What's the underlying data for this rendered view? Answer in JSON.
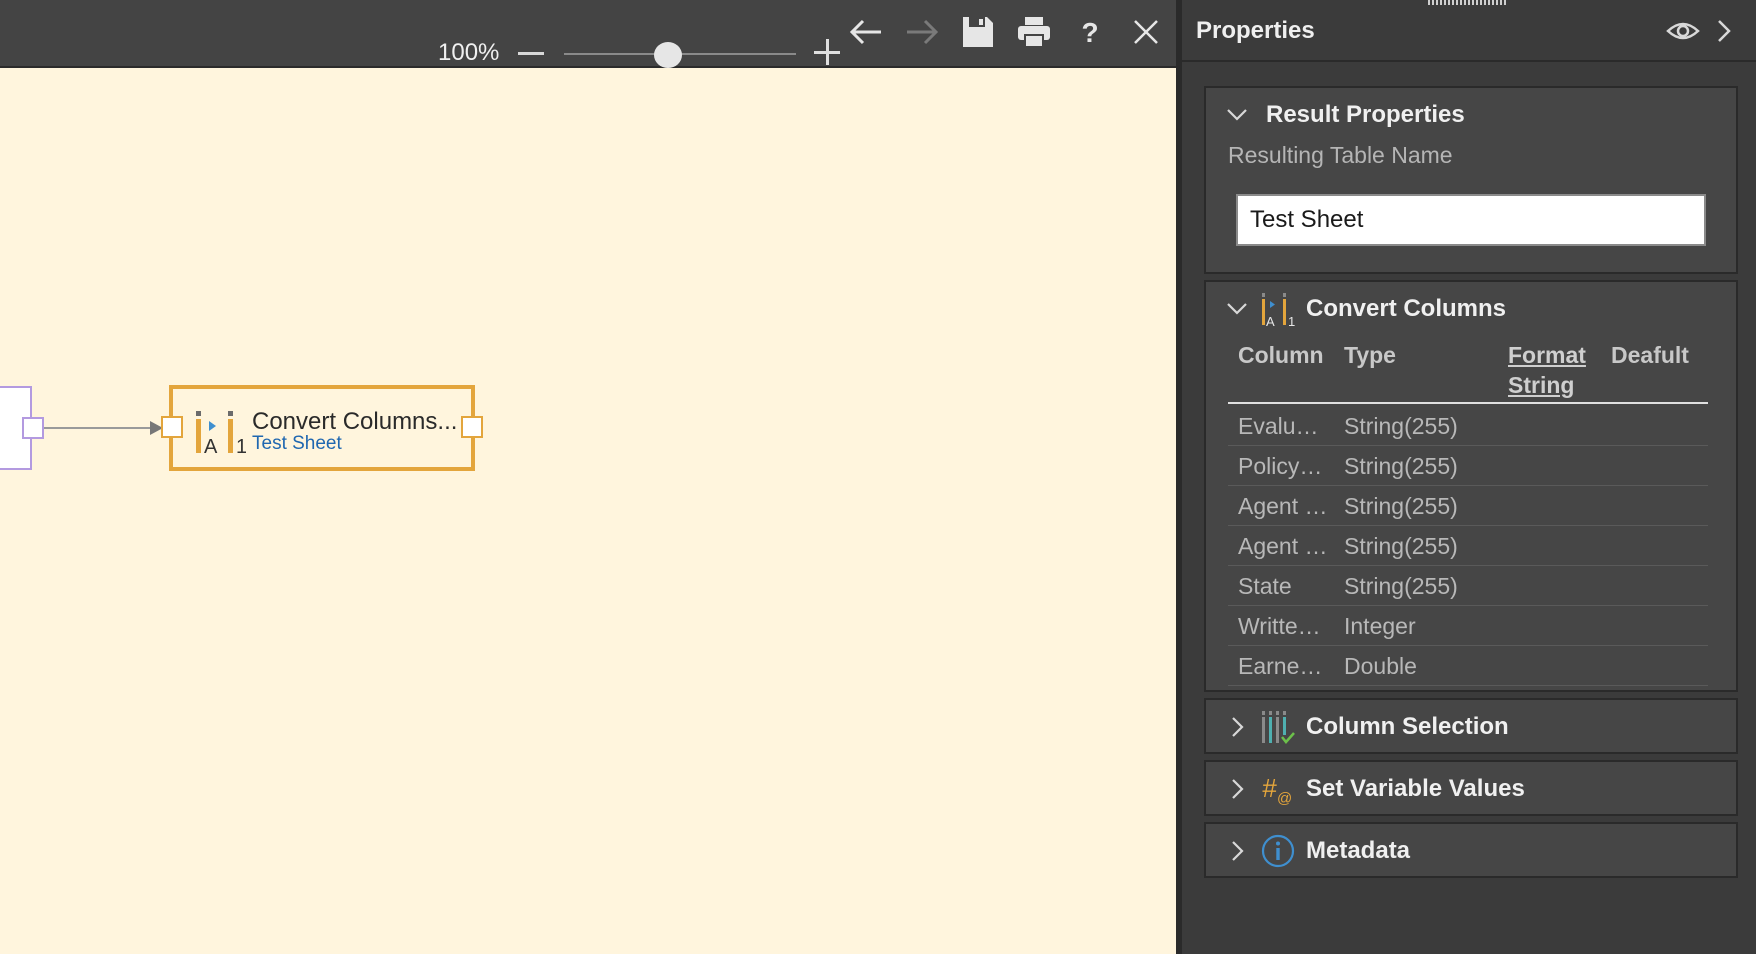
{
  "toolbar": {
    "zoom_label": "100%",
    "zoom_value": 0.45,
    "icons": [
      "back-arrow-icon",
      "forward-arrow-icon",
      "save-icon",
      "print-icon",
      "help-icon",
      "close-icon"
    ]
  },
  "canvas": {
    "background": "#fff5dd",
    "node": {
      "title": "Convert Columns...",
      "subtitle": "Test Sheet",
      "border_color": "#e3a53c"
    }
  },
  "panel": {
    "title": "Properties",
    "result": {
      "title": "Result Properties",
      "label": "Resulting Table Name",
      "value": "Test Sheet"
    },
    "convert": {
      "title": "Convert Columns",
      "headers": {
        "column": "Column",
        "type": "Type",
        "format_line1": "Format",
        "format_line2": "String",
        "default": "Deafult"
      },
      "rows": [
        {
          "column": "Evalu…",
          "type": "String(255)"
        },
        {
          "column": "Policy…",
          "type": "String(255)"
        },
        {
          "column": "Agent …",
          "type": "String(255)"
        },
        {
          "column": "Agent …",
          "type": "String(255)"
        },
        {
          "column": "State",
          "type": "String(255)"
        },
        {
          "column": "Writte…",
          "type": "Integer"
        },
        {
          "column": "Earne…",
          "type": "Double"
        }
      ]
    },
    "column_selection": {
      "title": "Column Selection"
    },
    "set_variable_values": {
      "title": "Set Variable Values"
    },
    "metadata": {
      "title": "Metadata"
    }
  }
}
